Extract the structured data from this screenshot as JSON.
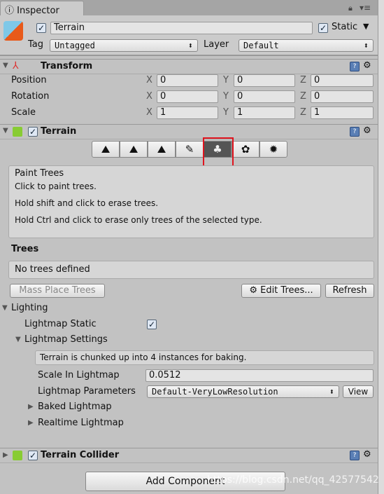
{
  "tab": {
    "title": "Inspector",
    "icon": "info-icon"
  },
  "object": {
    "name": "Terrain",
    "active": true,
    "static_label": "Static",
    "static": true,
    "tag_label": "Tag",
    "tag": "Untagged",
    "layer_label": "Layer",
    "layer": "Default"
  },
  "transform": {
    "title": "Transform",
    "rows": [
      {
        "label": "Position",
        "x": "0",
        "y": "0",
        "z": "0"
      },
      {
        "label": "Rotation",
        "x": "0",
        "y": "0",
        "z": "0"
      },
      {
        "label": "Scale",
        "x": "1",
        "y": "1",
        "z": "1"
      }
    ],
    "axes": [
      "X",
      "Y",
      "Z"
    ]
  },
  "terrain": {
    "title": "Terrain",
    "enabled": true,
    "tools": [
      "raise-lower-terrain",
      "paint-height",
      "smooth-height",
      "paint-texture",
      "place-trees",
      "paint-details",
      "terrain-settings"
    ],
    "selected_tool": 4,
    "help_title": "Paint Trees",
    "help_lines": [
      "Click to paint trees.",
      "Hold shift and click to erase trees.",
      "Hold Ctrl and click to erase only trees of the selected type."
    ],
    "trees_heading": "Trees",
    "trees_empty": "No trees defined",
    "mass_place": "Mass Place Trees",
    "edit_trees": "Edit Trees...",
    "refresh": "Refresh",
    "lighting": "Lighting",
    "lightmap_static": "Lightmap Static",
    "lightmap_static_value": true,
    "lightmap_settings": "Lightmap Settings",
    "chunk_info": "Terrain is chunked up into 4 instances for baking.",
    "scale_label": "Scale In Lightmap",
    "scale_value": "0.0512",
    "params_label": "Lightmap Parameters",
    "params_value": "Default-VeryLowResolution",
    "view": "View",
    "baked": "Baked Lightmap",
    "realtime": "Realtime Lightmap"
  },
  "collider": {
    "title": "Terrain Collider",
    "enabled": true
  },
  "add_component": "Add Component",
  "watermark": "https://blog.csdn.net/qq_42577542",
  "colors": {
    "selection": "#e0141e",
    "panel": "#c2c2c2"
  }
}
